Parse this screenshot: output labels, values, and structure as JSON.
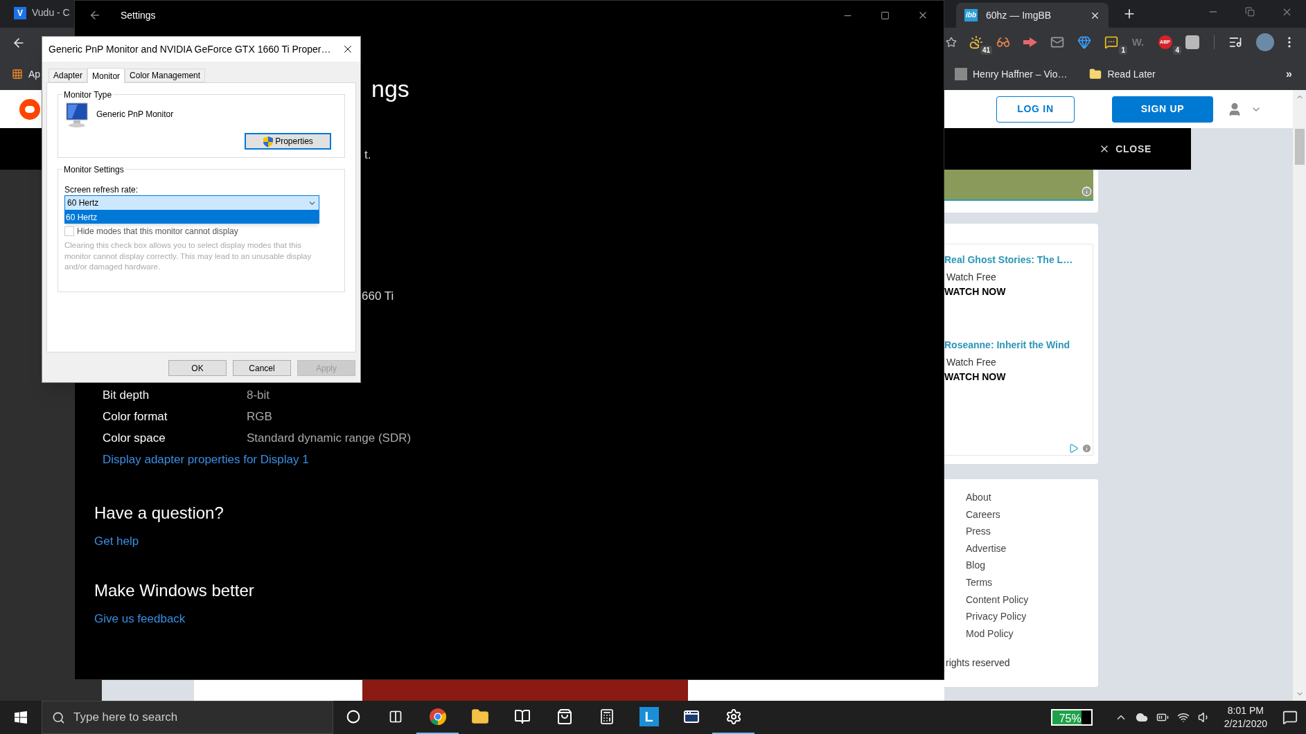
{
  "browser": {
    "tabs": [
      {
        "label": "Vudu - C",
        "icon_text": "V",
        "selected": false
      },
      {
        "label": "60hz — ImgBB",
        "icon_text": "ibb",
        "selected": true
      }
    ],
    "extensions": [
      {
        "kind": "weather",
        "badge": "41"
      },
      {
        "kind": "glasses"
      },
      {
        "kind": "arrow"
      },
      {
        "kind": "mail"
      },
      {
        "kind": "diamond"
      },
      {
        "kind": "note",
        "badge": "1"
      },
      {
        "kind": "wordmark",
        "text": "W."
      },
      {
        "kind": "adblock",
        "text": "ABP",
        "badge": "4"
      },
      {
        "kind": "grey"
      }
    ],
    "bookmarks": [
      {
        "kind": "apps",
        "label": "Ap"
      },
      {
        "kind": "page",
        "label": "Henry Haffner – Vio…"
      },
      {
        "kind": "folder",
        "label": "Read Later"
      }
    ],
    "bookmarks_overflow": "»"
  },
  "reddit": {
    "login": "LOG IN",
    "signup": "SIGN UP",
    "close": "CLOSE",
    "ads": [
      {
        "title": "Real Ghost Stories: The L…",
        "subtitle": "Watch Free",
        "cta": "WATCH NOW"
      },
      {
        "title": "Roseanne: Inherit the Wind",
        "subtitle": "Watch Free",
        "cta": "WATCH NOW"
      }
    ],
    "footer_links": [
      "About",
      "Careers",
      "Press",
      "Advertise",
      "Blog",
      "Terms",
      "Content Policy",
      "Privacy Policy",
      "Mod Policy"
    ],
    "copyright": "rights reserved"
  },
  "settings": {
    "title": "Settings",
    "fragments": [
      {
        "kind": "heading",
        "text": "ngs"
      },
      {
        "kind": "text",
        "text": "t."
      },
      {
        "kind": "text",
        "text": "660 Ti"
      }
    ],
    "rows": [
      {
        "label": "Bit depth",
        "value": "8-bit"
      },
      {
        "label": "Color format",
        "value": "RGB"
      },
      {
        "label": "Color space",
        "value": "Standard dynamic range (SDR)"
      }
    ],
    "adapter_link": "Display adapter properties for Display 1",
    "sections": [
      {
        "heading": "Have a question?",
        "link": "Get help"
      },
      {
        "heading": "Make Windows better",
        "link": "Give us feedback"
      }
    ]
  },
  "dialog": {
    "title": "Generic PnP Monitor and NVIDIA GeForce GTX 1660 Ti Proper…",
    "tabs": [
      {
        "label": "Adapter",
        "selected": false
      },
      {
        "label": "Monitor",
        "selected": true
      },
      {
        "label": "Color Management",
        "selected": false
      }
    ],
    "monitor_type": {
      "legend": "Monitor Type",
      "name": "Generic PnP Monitor",
      "button": "Properties"
    },
    "monitor_settings": {
      "legend": "Monitor Settings",
      "refresh_label": "Screen refresh rate:",
      "refresh_value": "60 Hertz",
      "options": [
        {
          "label": "60 Hertz",
          "selected": true
        }
      ],
      "hide_modes": {
        "label": "Hide modes that this monitor cannot display",
        "checked": false
      },
      "description": "Clearing this check box allows you to select display modes that this monitor cannot display correctly. This may lead to an unusable display and/or damaged hardware."
    },
    "buttons": [
      {
        "label": "OK",
        "disabled": false
      },
      {
        "label": "Cancel",
        "disabled": false
      },
      {
        "label": "Apply",
        "disabled": true
      }
    ]
  },
  "taskbar": {
    "search_placeholder": "Type here to search",
    "apps": [
      {
        "kind": "cortana",
        "running": false
      },
      {
        "kind": "taskview",
        "running": false
      },
      {
        "kind": "chrome",
        "running": true
      },
      {
        "kind": "explorer",
        "running": false
      },
      {
        "kind": "book",
        "running": false
      },
      {
        "kind": "store",
        "running": false
      },
      {
        "kind": "calculator",
        "running": false
      },
      {
        "kind": "letter",
        "text": "L",
        "running": false
      },
      {
        "kind": "app",
        "running": false
      },
      {
        "kind": "settings",
        "running": true
      }
    ],
    "battery": {
      "text": "75%",
      "level": 0.75
    },
    "time": "8:01 PM",
    "date": "2/21/2020"
  }
}
